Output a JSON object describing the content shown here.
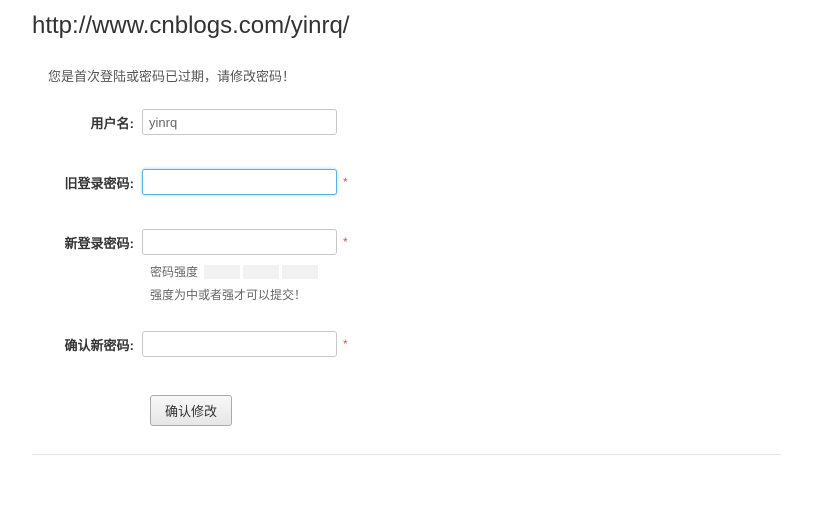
{
  "header": {
    "url": "http://www.cnblogs.com/yinrq/"
  },
  "instruction": "您是首次登陆或密码已过期，请修改密码！",
  "form": {
    "username": {
      "label": "用户名:",
      "value": "yinrq"
    },
    "oldPassword": {
      "label": "旧登录密码:",
      "value": "",
      "required": "*"
    },
    "newPassword": {
      "label": "新登录密码:",
      "value": "",
      "required": "*"
    },
    "strength": {
      "label": "密码强度",
      "hint": "强度为中或者强才可以提交！"
    },
    "confirmPassword": {
      "label": "确认新密码:",
      "value": "",
      "required": "*"
    },
    "submit": "确认修改"
  }
}
